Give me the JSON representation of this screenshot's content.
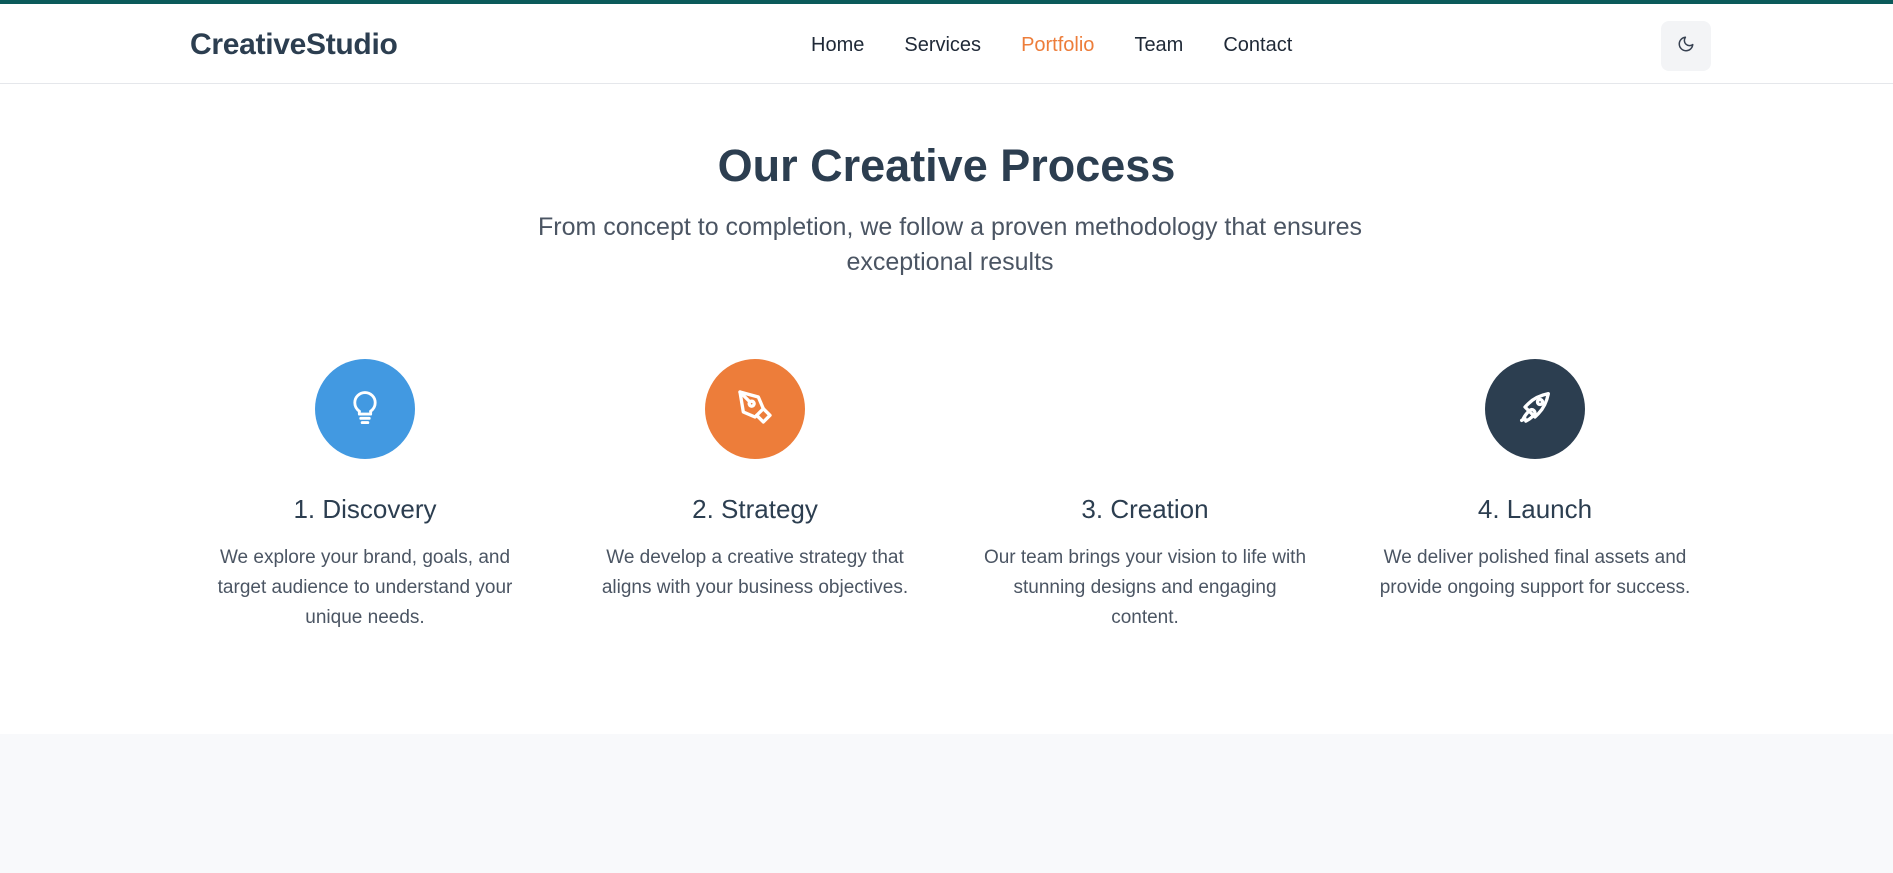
{
  "brand": {
    "name": "CreativeStudio"
  },
  "nav": {
    "items": [
      {
        "label": "Home",
        "active": false
      },
      {
        "label": "Services",
        "active": false
      },
      {
        "label": "Portfolio",
        "active": true
      },
      {
        "label": "Team",
        "active": false
      },
      {
        "label": "Contact",
        "active": false
      }
    ],
    "theme_toggle_icon": "moon-icon"
  },
  "hero": {
    "title": "Our Creative Process",
    "subtitle": "From concept to completion, we follow a proven methodology that ensures exceptional results"
  },
  "steps": [
    {
      "title": "1. Discovery",
      "text": "We explore your brand, goals, and target audience to understand your unique needs.",
      "icon": "lightbulb-icon",
      "color": "#4299e1"
    },
    {
      "title": "2. Strategy",
      "text": "We develop a creative strategy that aligns with your business objectives.",
      "icon": "pen-tool-icon",
      "color": "#ed7d3a"
    },
    {
      "title": "3. Creation",
      "text": "Our team brings your vision to life with stunning designs and engaging content.",
      "icon": "none",
      "color": "#ffffff"
    },
    {
      "title": "4. Launch",
      "text": "We deliver polished final assets and provide ongoing support for success.",
      "icon": "rocket-icon",
      "color": "#2c3e50"
    }
  ],
  "colors": {
    "accent": "#ed7d3a",
    "primary_text": "#2c3e50",
    "top_border": "#0b5a5a"
  }
}
